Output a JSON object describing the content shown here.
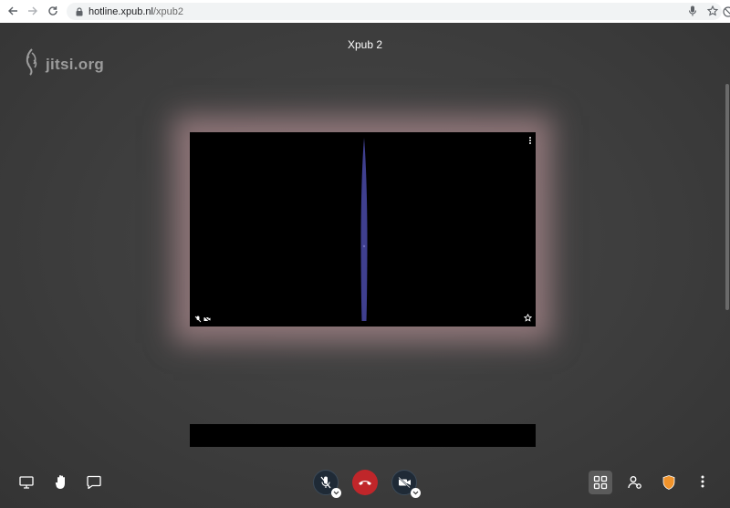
{
  "browser": {
    "url_host": "hotline.xpub.nl",
    "url_path": "/xpub2"
  },
  "meeting": {
    "brand": "jitsi.org",
    "room_title": "Xpub 2",
    "main_tile": {
      "pin_icon": "star-icon",
      "menu_icon": "more-vertical-icon"
    }
  },
  "toolbar": {
    "left": [
      "screen-share-icon",
      "raise-hand-icon",
      "chat-icon"
    ],
    "center": [
      "mic-muted-icon",
      "hangup-icon",
      "camera-off-icon"
    ],
    "right": [
      "tile-view-icon",
      "participants-icon",
      "security-shield-icon",
      "more-vertical-icon"
    ]
  },
  "colors": {
    "hangup": "#c0262a",
    "shield": "#f0932b",
    "glow": "#cda0a5",
    "blob": "#3f3f8f"
  }
}
